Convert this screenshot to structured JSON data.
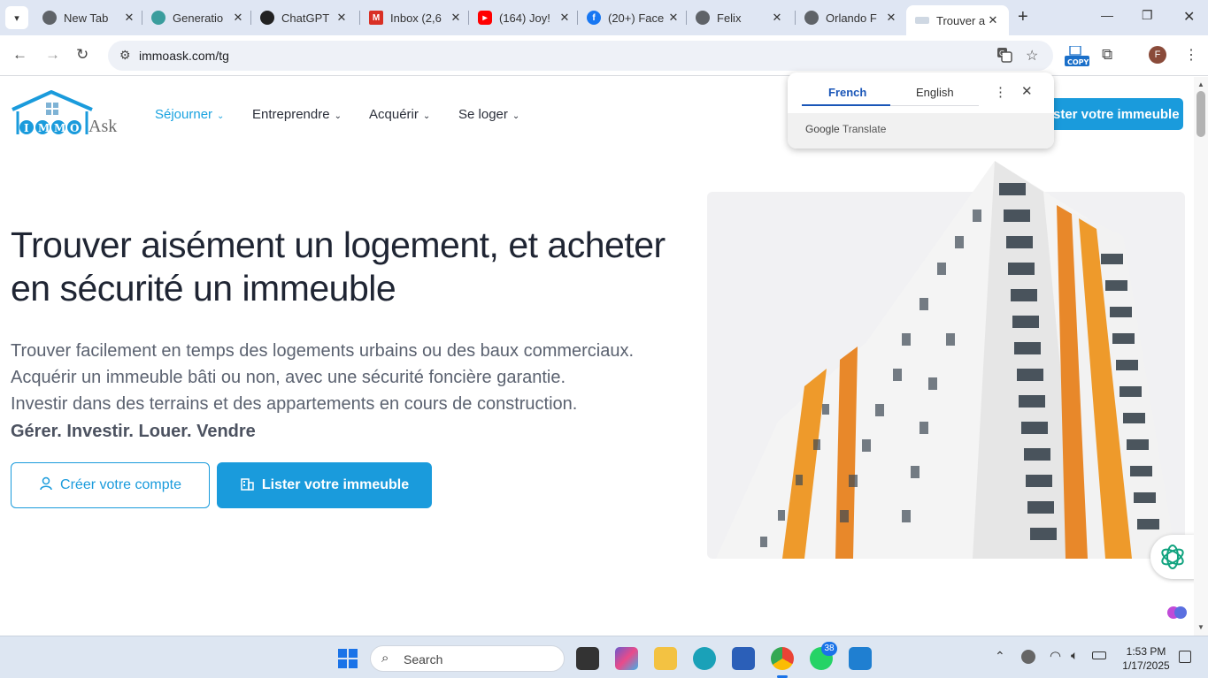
{
  "tabs": [
    {
      "title": "New Tab",
      "color": "#5f6368"
    },
    {
      "title": "Generatio",
      "color": "#3a9d9d"
    },
    {
      "title": "ChatGPT",
      "color": "#222222"
    },
    {
      "title": "Inbox (2,6",
      "color": "#d93025"
    },
    {
      "title": "(164) Joy!",
      "color": "#ff0000"
    },
    {
      "title": "(20+) Face",
      "color": "#1877f2"
    },
    {
      "title": "Felix",
      "color": "#5f6368"
    },
    {
      "title": "Orlando F",
      "color": "#5f6368"
    },
    {
      "title": "Trouver ai",
      "color": "#cfd8e3"
    }
  ],
  "toolbar": {
    "url": "immoask.com/tg",
    "copy_badge": "COPY",
    "profile_initial": "F"
  },
  "translate_popup": {
    "lang_from": "French",
    "lang_to": "English",
    "brand": "Google",
    "brand_suffix": "Translate"
  },
  "site": {
    "logo_letters": [
      "I",
      "M",
      "M",
      "O"
    ],
    "logo_ask": "Ask",
    "nav": [
      {
        "label": "Séjourner",
        "active": true
      },
      {
        "label": "Entreprendre",
        "active": false
      },
      {
        "label": "Acquérir",
        "active": false
      },
      {
        "label": "Se loger",
        "active": false
      }
    ],
    "header_cta": "ster votre immeuble",
    "hero_title": "Trouver aisément un logement, et acheter en sécurité un immeuble",
    "hero_lines": [
      "Trouver facilement en temps des logements urbains ou des baux commerciaux.",
      "Acquérir un immeuble bâti ou non, avec une sécurité foncière garantie.",
      "Investir dans des terrains et des appartements en cours de construction."
    ],
    "hero_bold": "Gérer. Investir. Louer. Vendre",
    "btn_account": "Créer votre compte",
    "btn_list": "Lister votre immeuble"
  },
  "taskbar": {
    "search_label": "Search",
    "whatsapp_badge": "38",
    "time": "1:53 PM",
    "date": "1/17/2025"
  }
}
